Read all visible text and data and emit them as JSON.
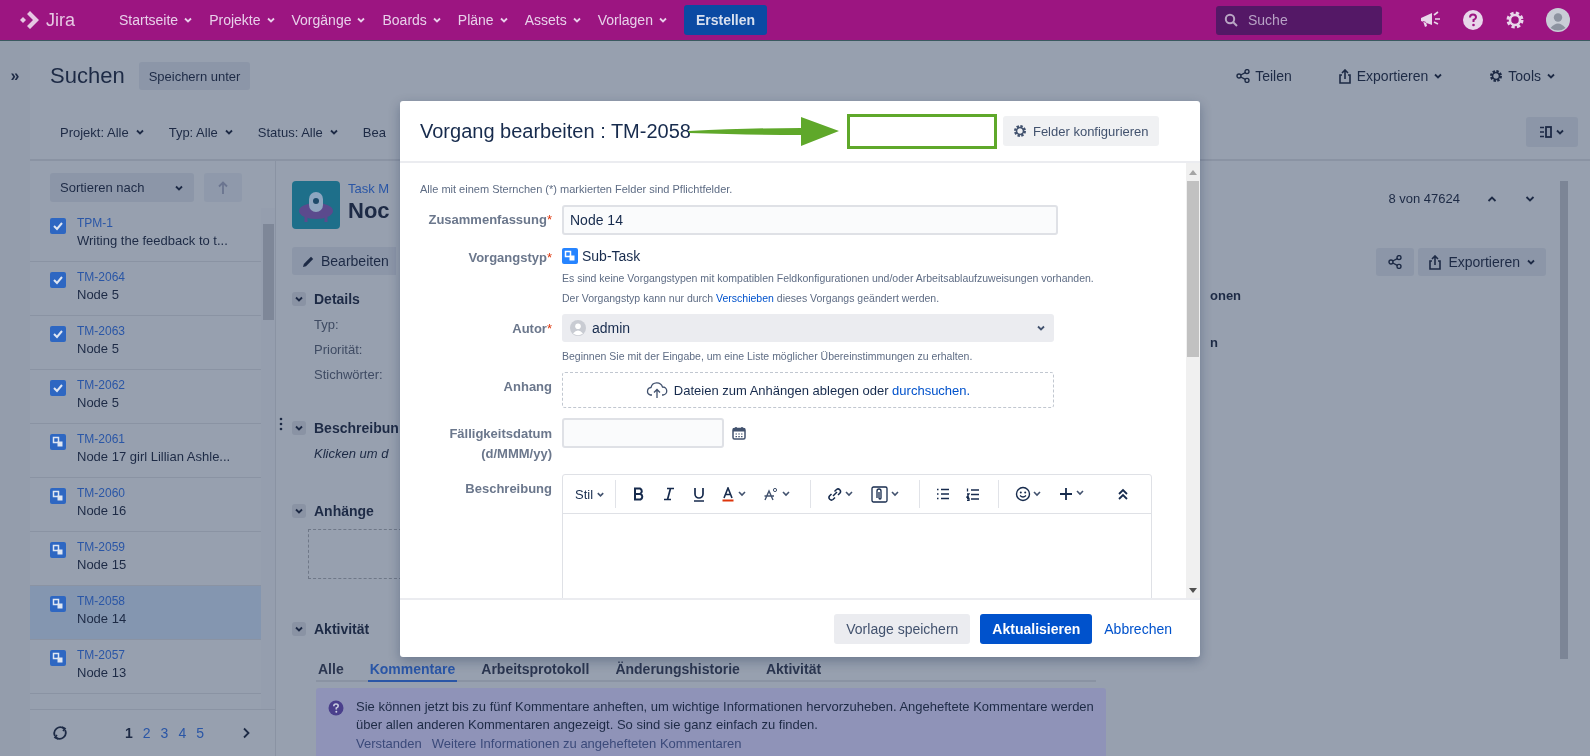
{
  "topbar": {
    "logo": "Jira",
    "nav": [
      {
        "label": "Startseite"
      },
      {
        "label": "Projekte"
      },
      {
        "label": "Vorgänge"
      },
      {
        "label": "Boards"
      },
      {
        "label": "Pläne"
      },
      {
        "label": "Assets"
      },
      {
        "label": "Vorlagen"
      }
    ],
    "create": "Erstellen",
    "search": {
      "placeholder": "Suche"
    }
  },
  "sidebar_toggle": "»",
  "page": {
    "title": "Suchen",
    "save_as": "Speichern unter",
    "actions": [
      {
        "label": "Teilen",
        "kind": "share",
        "menu": false
      },
      {
        "label": "Exportieren",
        "kind": "export",
        "menu": true
      },
      {
        "label": "Tools",
        "kind": "tools",
        "menu": true
      }
    ],
    "filters": [
      "Projekt: Alle",
      "Typ: Alle",
      "Status: Alle",
      "Bea"
    ]
  },
  "results": {
    "sort": "Sortieren nach",
    "items": [
      {
        "key": "TPM-1",
        "summary": "Writing the feedback to t...",
        "kind": "task",
        "selected": false
      },
      {
        "key": "TM-2064",
        "summary": "Node 5",
        "kind": "task",
        "selected": false
      },
      {
        "key": "TM-2063",
        "summary": "Node 5",
        "kind": "task",
        "selected": false
      },
      {
        "key": "TM-2062",
        "summary": "Node 5",
        "kind": "task",
        "selected": false
      },
      {
        "key": "TM-2061",
        "summary": "Node 17 girl Lillian Ashle...",
        "kind": "subtask",
        "selected": false
      },
      {
        "key": "TM-2060",
        "summary": "Node 16",
        "kind": "subtask",
        "selected": false
      },
      {
        "key": "TM-2059",
        "summary": "Node 15",
        "kind": "subtask",
        "selected": false
      },
      {
        "key": "TM-2058",
        "summary": "Node 14",
        "kind": "subtask",
        "selected": true
      },
      {
        "key": "TM-2057",
        "summary": "Node 13",
        "kind": "subtask",
        "selected": false
      }
    ],
    "pages": [
      {
        "label": "1",
        "selected": true
      },
      {
        "label": "2",
        "selected": false
      },
      {
        "label": "3",
        "selected": false
      },
      {
        "label": "4",
        "selected": false
      },
      {
        "label": "5",
        "selected": false
      }
    ]
  },
  "issue": {
    "project": "Task M",
    "title": "Noc",
    "edit": "Bearbeiten",
    "counter": "8 von 47624",
    "export": "Exportieren",
    "details": {
      "heading": "Details",
      "fields": [
        "Typ:",
        "Priorität:",
        "Stichwörter:"
      ]
    },
    "description": {
      "heading": "Beschreibun",
      "placeholder": "Klicken um d"
    },
    "attachments": {
      "heading": "Anhänge"
    },
    "right_fragments": [
      "onen",
      "n"
    ],
    "activity": {
      "heading": "Aktivität",
      "tabs": [
        {
          "label": "Alle",
          "selected": false
        },
        {
          "label": "Kommentare",
          "selected": true
        },
        {
          "label": "Arbeitsprotokoll",
          "selected": false
        },
        {
          "label": "Änderungshistorie",
          "selected": false
        },
        {
          "label": "Aktivität",
          "selected": false
        }
      ],
      "notice": "Sie können jetzt bis zu fünf Kommentare anheften, um wichtige Informationen hervorzuheben. Angeheftete Kommentare werden über allen anderen Kommentaren angezeigt. So sind sie ganz einfach zu finden.",
      "links": [
        "Verstanden",
        "Weitere Informationen zu angehefteten Kommentaren"
      ]
    }
  },
  "dialog": {
    "title": "Vorgang bearbeiten : TM-2058",
    "configure": "Felder konfigurieren",
    "required_note": "Alle mit einem Sternchen (*) markierten Felder sind Pflichtfelder.",
    "fields": [
      {
        "kind": "text",
        "label": "Zusammenfassung",
        "mark": "*",
        "value": "Node 14"
      },
      {
        "kind": "issuetype",
        "label": "Vorgangstyp",
        "mark": "*",
        "value": "Sub-Task",
        "hint": "Es sind keine Vorgangstypen mit kompatiblen Feldkonfigurationen und/oder Arbeitsablaufzuweisungen vorhanden.",
        "hint2": [
          "Der Vorgangstyp kann nur durch ",
          "Verschieben",
          " dieses Vorgangs geändert werden."
        ]
      },
      {
        "kind": "user",
        "label": "Autor",
        "mark": "*",
        "value": "admin",
        "hint": "Beginnen Sie mit der Eingabe, um eine Liste möglicher Übereinstimmungen zu erhalten."
      },
      {
        "kind": "attachment",
        "label": "Anhang",
        "text": "Dateien zum Anhängen ablegen oder",
        "link": "durchsuchen."
      },
      {
        "kind": "date",
        "label": "Fälligkeitsdatum (d/MMM/yy)"
      },
      {
        "kind": "editor",
        "label": "Beschreibung",
        "style": "Stil"
      }
    ],
    "buttons": {
      "save_template": "Vorlage speichern",
      "update": "Aktualisieren",
      "cancel": "Abbrechen"
    }
  }
}
